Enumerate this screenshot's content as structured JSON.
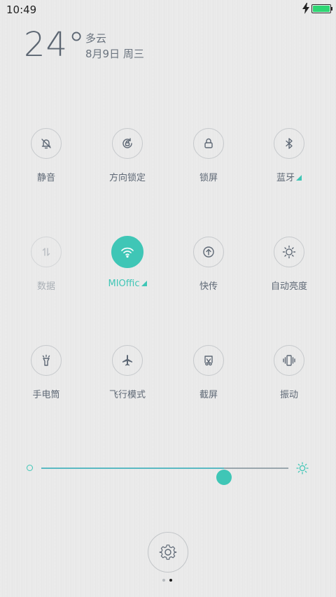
{
  "status": {
    "time": "10:49",
    "battery_level": 1.0
  },
  "weather": {
    "temperature": "24°",
    "condition": "多云",
    "date": "8月9日 周三"
  },
  "toggles": [
    {
      "label": "静音",
      "icon": "bell-off-icon",
      "state": "off"
    },
    {
      "label": "方向锁定",
      "icon": "rotation-lock-icon",
      "state": "off"
    },
    {
      "label": "锁屏",
      "icon": "lock-icon",
      "state": "off"
    },
    {
      "label": "蓝牙",
      "icon": "bluetooth-icon",
      "state": "off",
      "has_more": true
    },
    {
      "label": "数据",
      "icon": "mobile-data-icon",
      "state": "disabled"
    },
    {
      "label": "MIOffic",
      "icon": "wifi-icon",
      "state": "on",
      "has_more": true
    },
    {
      "label": "快传",
      "icon": "quick-share-icon",
      "state": "off"
    },
    {
      "label": "自动亮度",
      "icon": "auto-brightness-icon",
      "state": "off"
    },
    {
      "label": "手电筒",
      "icon": "flashlight-icon",
      "state": "off"
    },
    {
      "label": "飞行模式",
      "icon": "airplane-icon",
      "state": "off"
    },
    {
      "label": "截屏",
      "icon": "screenshot-icon",
      "state": "off"
    },
    {
      "label": "振动",
      "icon": "vibrate-icon",
      "state": "off"
    }
  ],
  "brightness": {
    "level": 0.74
  },
  "pager": {
    "pages": 2,
    "current": 2
  },
  "colors": {
    "accent": "#3fc6b6",
    "text": "#5e6875",
    "disabled": "#aab0b6"
  }
}
